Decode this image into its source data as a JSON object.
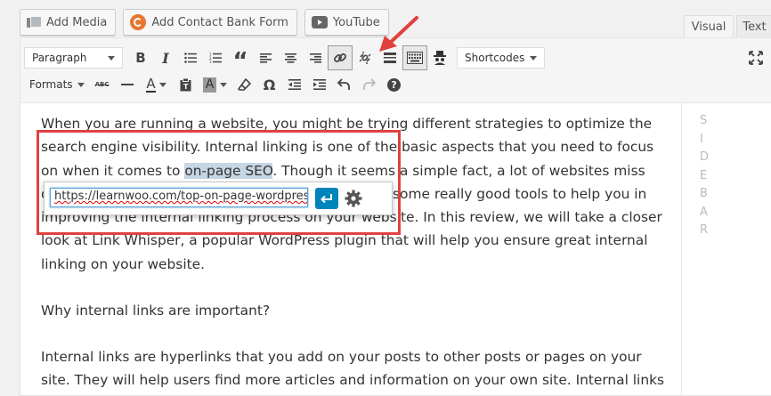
{
  "media_buttons": [
    {
      "label": "Add Media",
      "icon": "media-icon"
    },
    {
      "label": "Add Contact Bank Form",
      "icon": "contact-bank-icon"
    },
    {
      "label": "YouTube",
      "icon": "youtube-icon"
    }
  ],
  "tabs": {
    "visual": "Visual",
    "text": "Text"
  },
  "toolbar": {
    "paragraph_select": "Paragraph",
    "shortcodes_select": "Shortcodes",
    "formats_label": "Formats",
    "strikethrough_label": "ABC",
    "special_char_label": "Ω",
    "text_color_label": "A",
    "background_color_label": "A",
    "bold_label": "B",
    "italic_label": "I",
    "quote_label": "“",
    "help_label": "?"
  },
  "content": {
    "p1_before": "When you are running a website, you might be trying different strategies to optimize the search engine visibility. Internal linking is one of the basic aspects that you need to focus on when it comes to ",
    "p1_link": "on-page SEO",
    "p1_after": ". Though it seems a simple fact, a lot of websites miss out on proper internal linking strategies. There are some really good tools to help you in improving the internal linking process on your website. In this review, we will take a closer look at Link Whisper, a popular WordPress plugin that will help you ensure great internal linking on your website.",
    "p2": "Why internal links are important?",
    "p3": "Internal links are hyperlinks that you add on your posts to other posts or pages on your site. They will help users find more articles and information on your own site. Internal links"
  },
  "link_popup": {
    "url_value": "https://learnwoo.com/top-on-page-wordpress-"
  },
  "sidebar": {
    "letters": [
      "S",
      "I",
      "D",
      "E",
      "B",
      "A",
      "R"
    ]
  },
  "colors": {
    "highlight_box": "#e0413f",
    "apply_button": "#0085ba",
    "selection": "#c7d6e3"
  }
}
